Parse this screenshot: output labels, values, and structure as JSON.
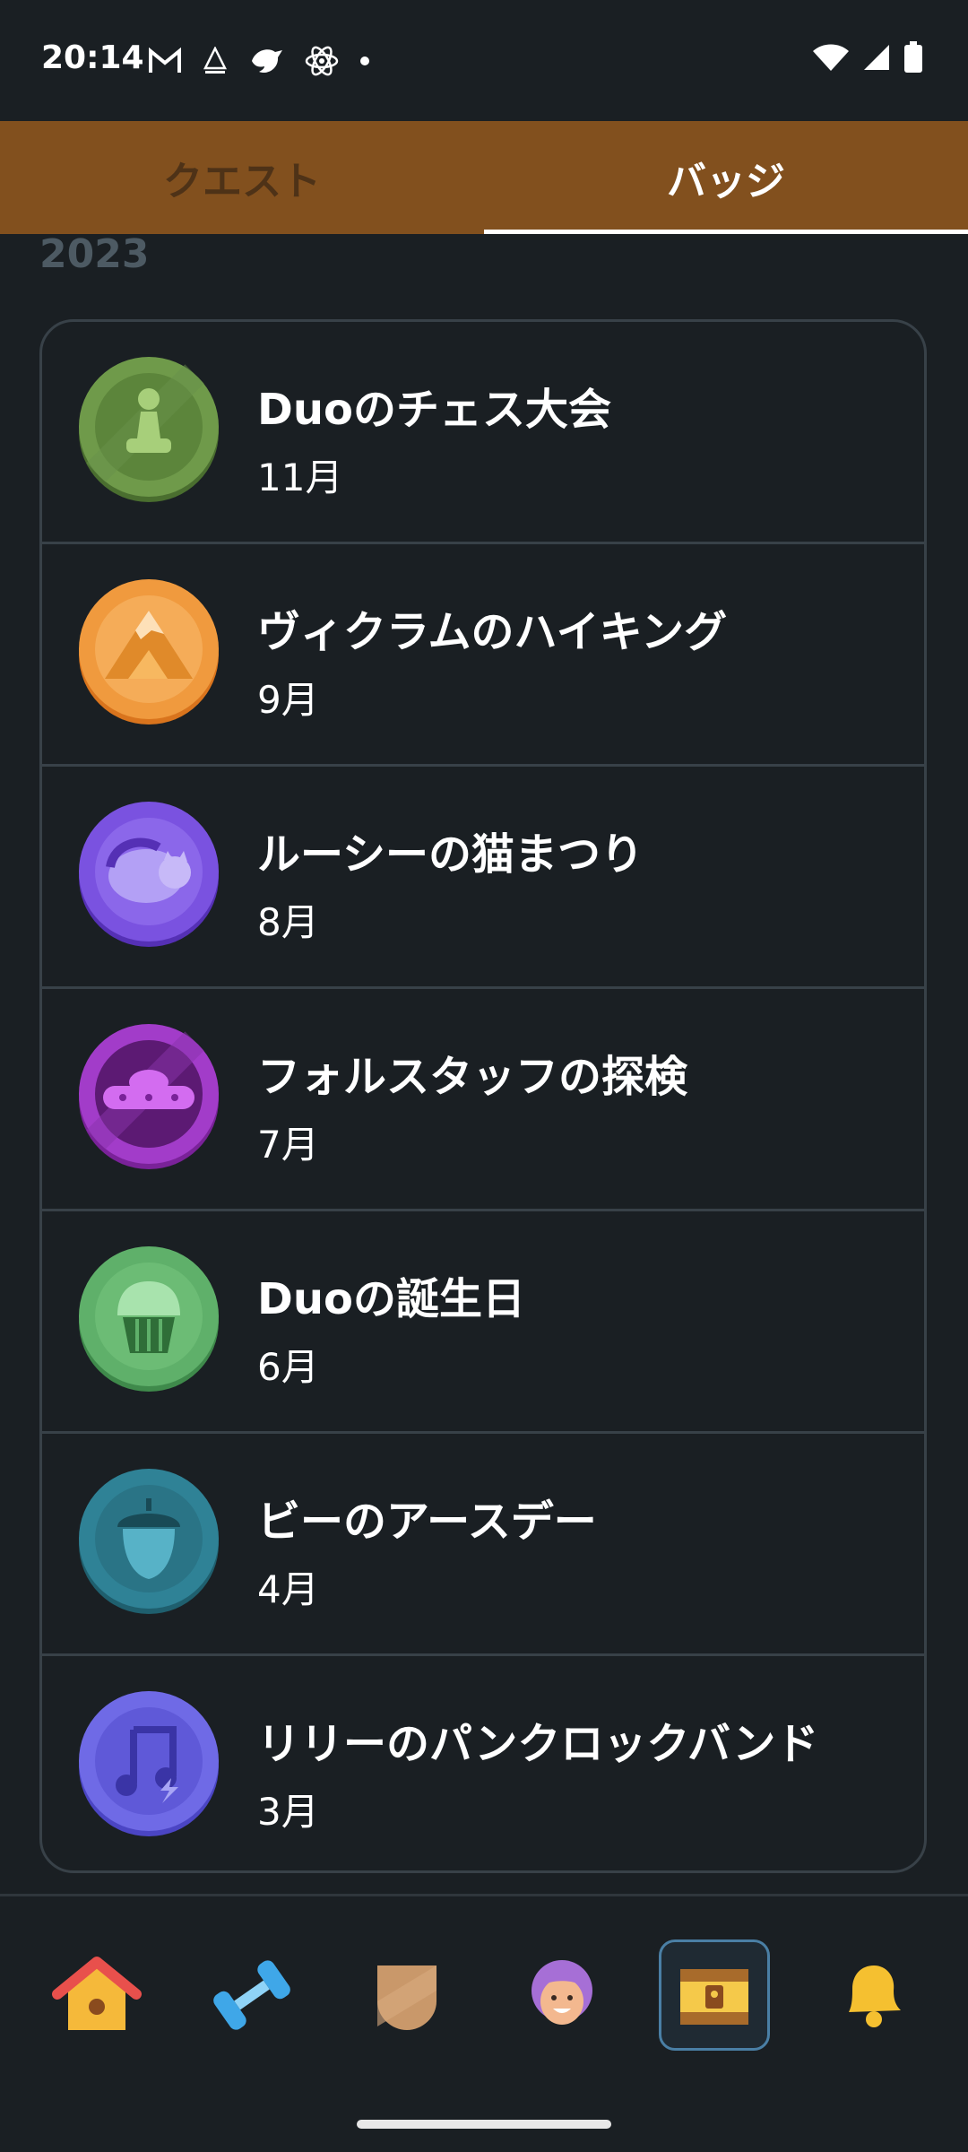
{
  "status_bar": {
    "time": "20:14",
    "left_icons": [
      "gmail-icon",
      "atom-app-icon",
      "bird-icon",
      "atom-icon",
      "dot-icon"
    ],
    "right_icons": [
      "wifi-icon",
      "signal-icon",
      "battery-icon"
    ]
  },
  "tabs": [
    {
      "label": "クエスト",
      "selected": false
    },
    {
      "label": "バッジ",
      "selected": true
    }
  ],
  "year": "2023",
  "badges": [
    {
      "title": "Duoのチェス大会",
      "month": "11月",
      "icon": "chess-pawn-badge-icon",
      "color": "#6f9a4a"
    },
    {
      "title": "ヴィクラムのハイキング",
      "month": "9月",
      "icon": "mountain-badge-icon",
      "color": "#f09a3e"
    },
    {
      "title": "ルーシーの猫まつり",
      "month": "8月",
      "icon": "cat-badge-icon",
      "color": "#7a52e0"
    },
    {
      "title": "フォルスタッフの探検",
      "month": "7月",
      "icon": "ufo-badge-icon",
      "color": "#a23cc9"
    },
    {
      "title": "Duoの誕生日",
      "month": "6月",
      "icon": "cupcake-badge-icon",
      "color": "#5fb06a"
    },
    {
      "title": "ビーのアースデー",
      "month": "4月",
      "icon": "acorn-badge-icon",
      "color": "#2f8296"
    },
    {
      "title": "リリーのパンクロックバンド",
      "month": "3月",
      "icon": "music-note-badge-icon",
      "color": "#6f6ae6"
    }
  ],
  "bottom_nav": [
    {
      "name": "home-icon",
      "selected": false
    },
    {
      "name": "practice-dumbbell-icon",
      "selected": false
    },
    {
      "name": "league-shield-icon",
      "selected": false
    },
    {
      "name": "profile-avatar-icon",
      "selected": false
    },
    {
      "name": "treasure-chest-icon",
      "selected": true
    },
    {
      "name": "notifications-bell-icon",
      "selected": false
    }
  ]
}
